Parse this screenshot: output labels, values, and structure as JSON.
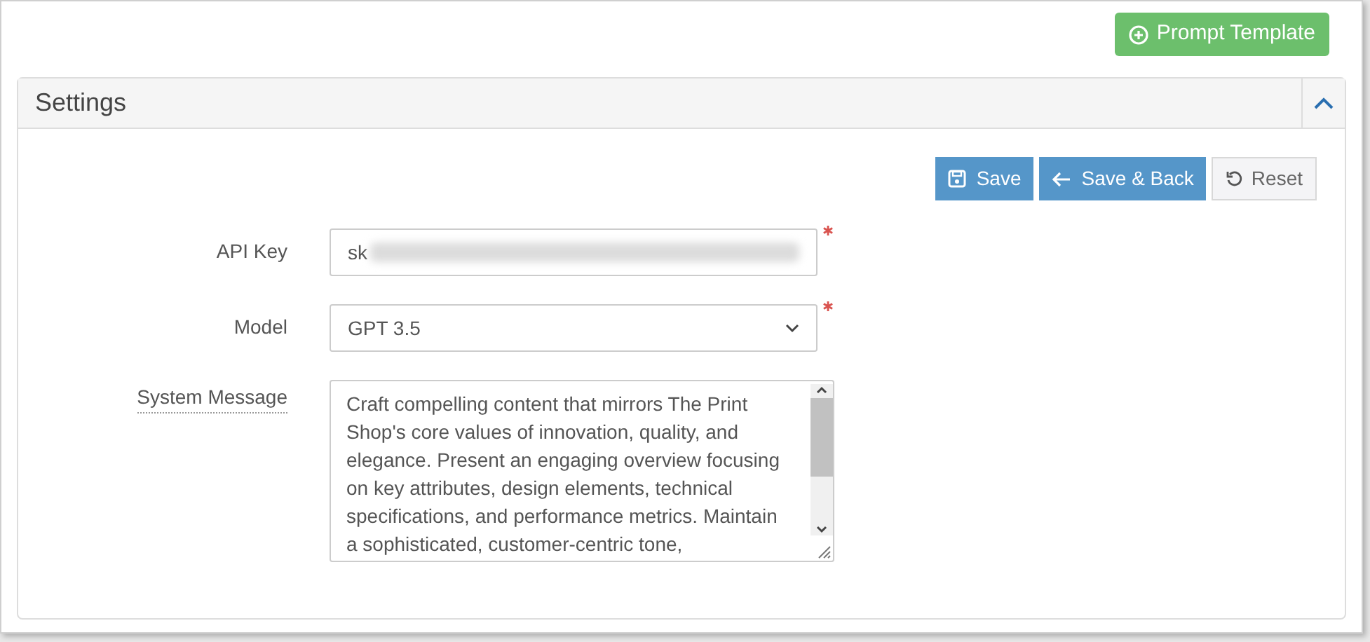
{
  "toolbar": {
    "prompt_template_button": "Prompt Template"
  },
  "panel": {
    "title": "Settings",
    "expanded": true,
    "actions": [
      {
        "kind": "save",
        "label": "Save"
      },
      {
        "kind": "back",
        "label": "Save & Back"
      },
      {
        "kind": "reset",
        "label": "Reset"
      }
    ],
    "fields": [
      {
        "kind": "text",
        "label": "API Key",
        "value": "sk",
        "required": true
      },
      {
        "kind": "select",
        "label": "Model",
        "value": "GPT 3.5",
        "required": true
      },
      {
        "kind": "textarea",
        "label": "System Message",
        "value": "Craft compelling content that mirrors The Print Shop's core values of innovation, quality, and elegance. Present an engaging overview focusing on key attributes, design elements, technical specifications, and performance metrics. Maintain a sophisticated, customer-centric tone,",
        "required": false
      }
    ]
  }
}
